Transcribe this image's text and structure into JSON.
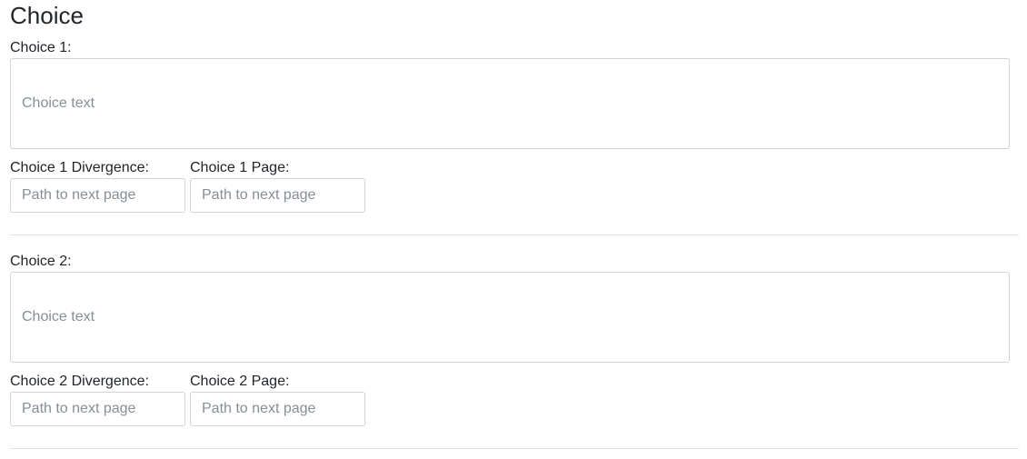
{
  "page": {
    "title": "Choice"
  },
  "choices": [
    {
      "label": "Choice 1:",
      "text_placeholder": "Choice text",
      "divergence_label": "Choice 1 Divergence:",
      "divergence_placeholder": "Path to next page",
      "page_label": "Choice 1 Page:",
      "page_placeholder": "Path to next page"
    },
    {
      "label": "Choice 2:",
      "text_placeholder": "Choice text",
      "divergence_label": "Choice 2 Divergence:",
      "divergence_placeholder": "Path to next page",
      "page_label": "Choice 2 Page:",
      "page_placeholder": "Path to next page"
    }
  ]
}
